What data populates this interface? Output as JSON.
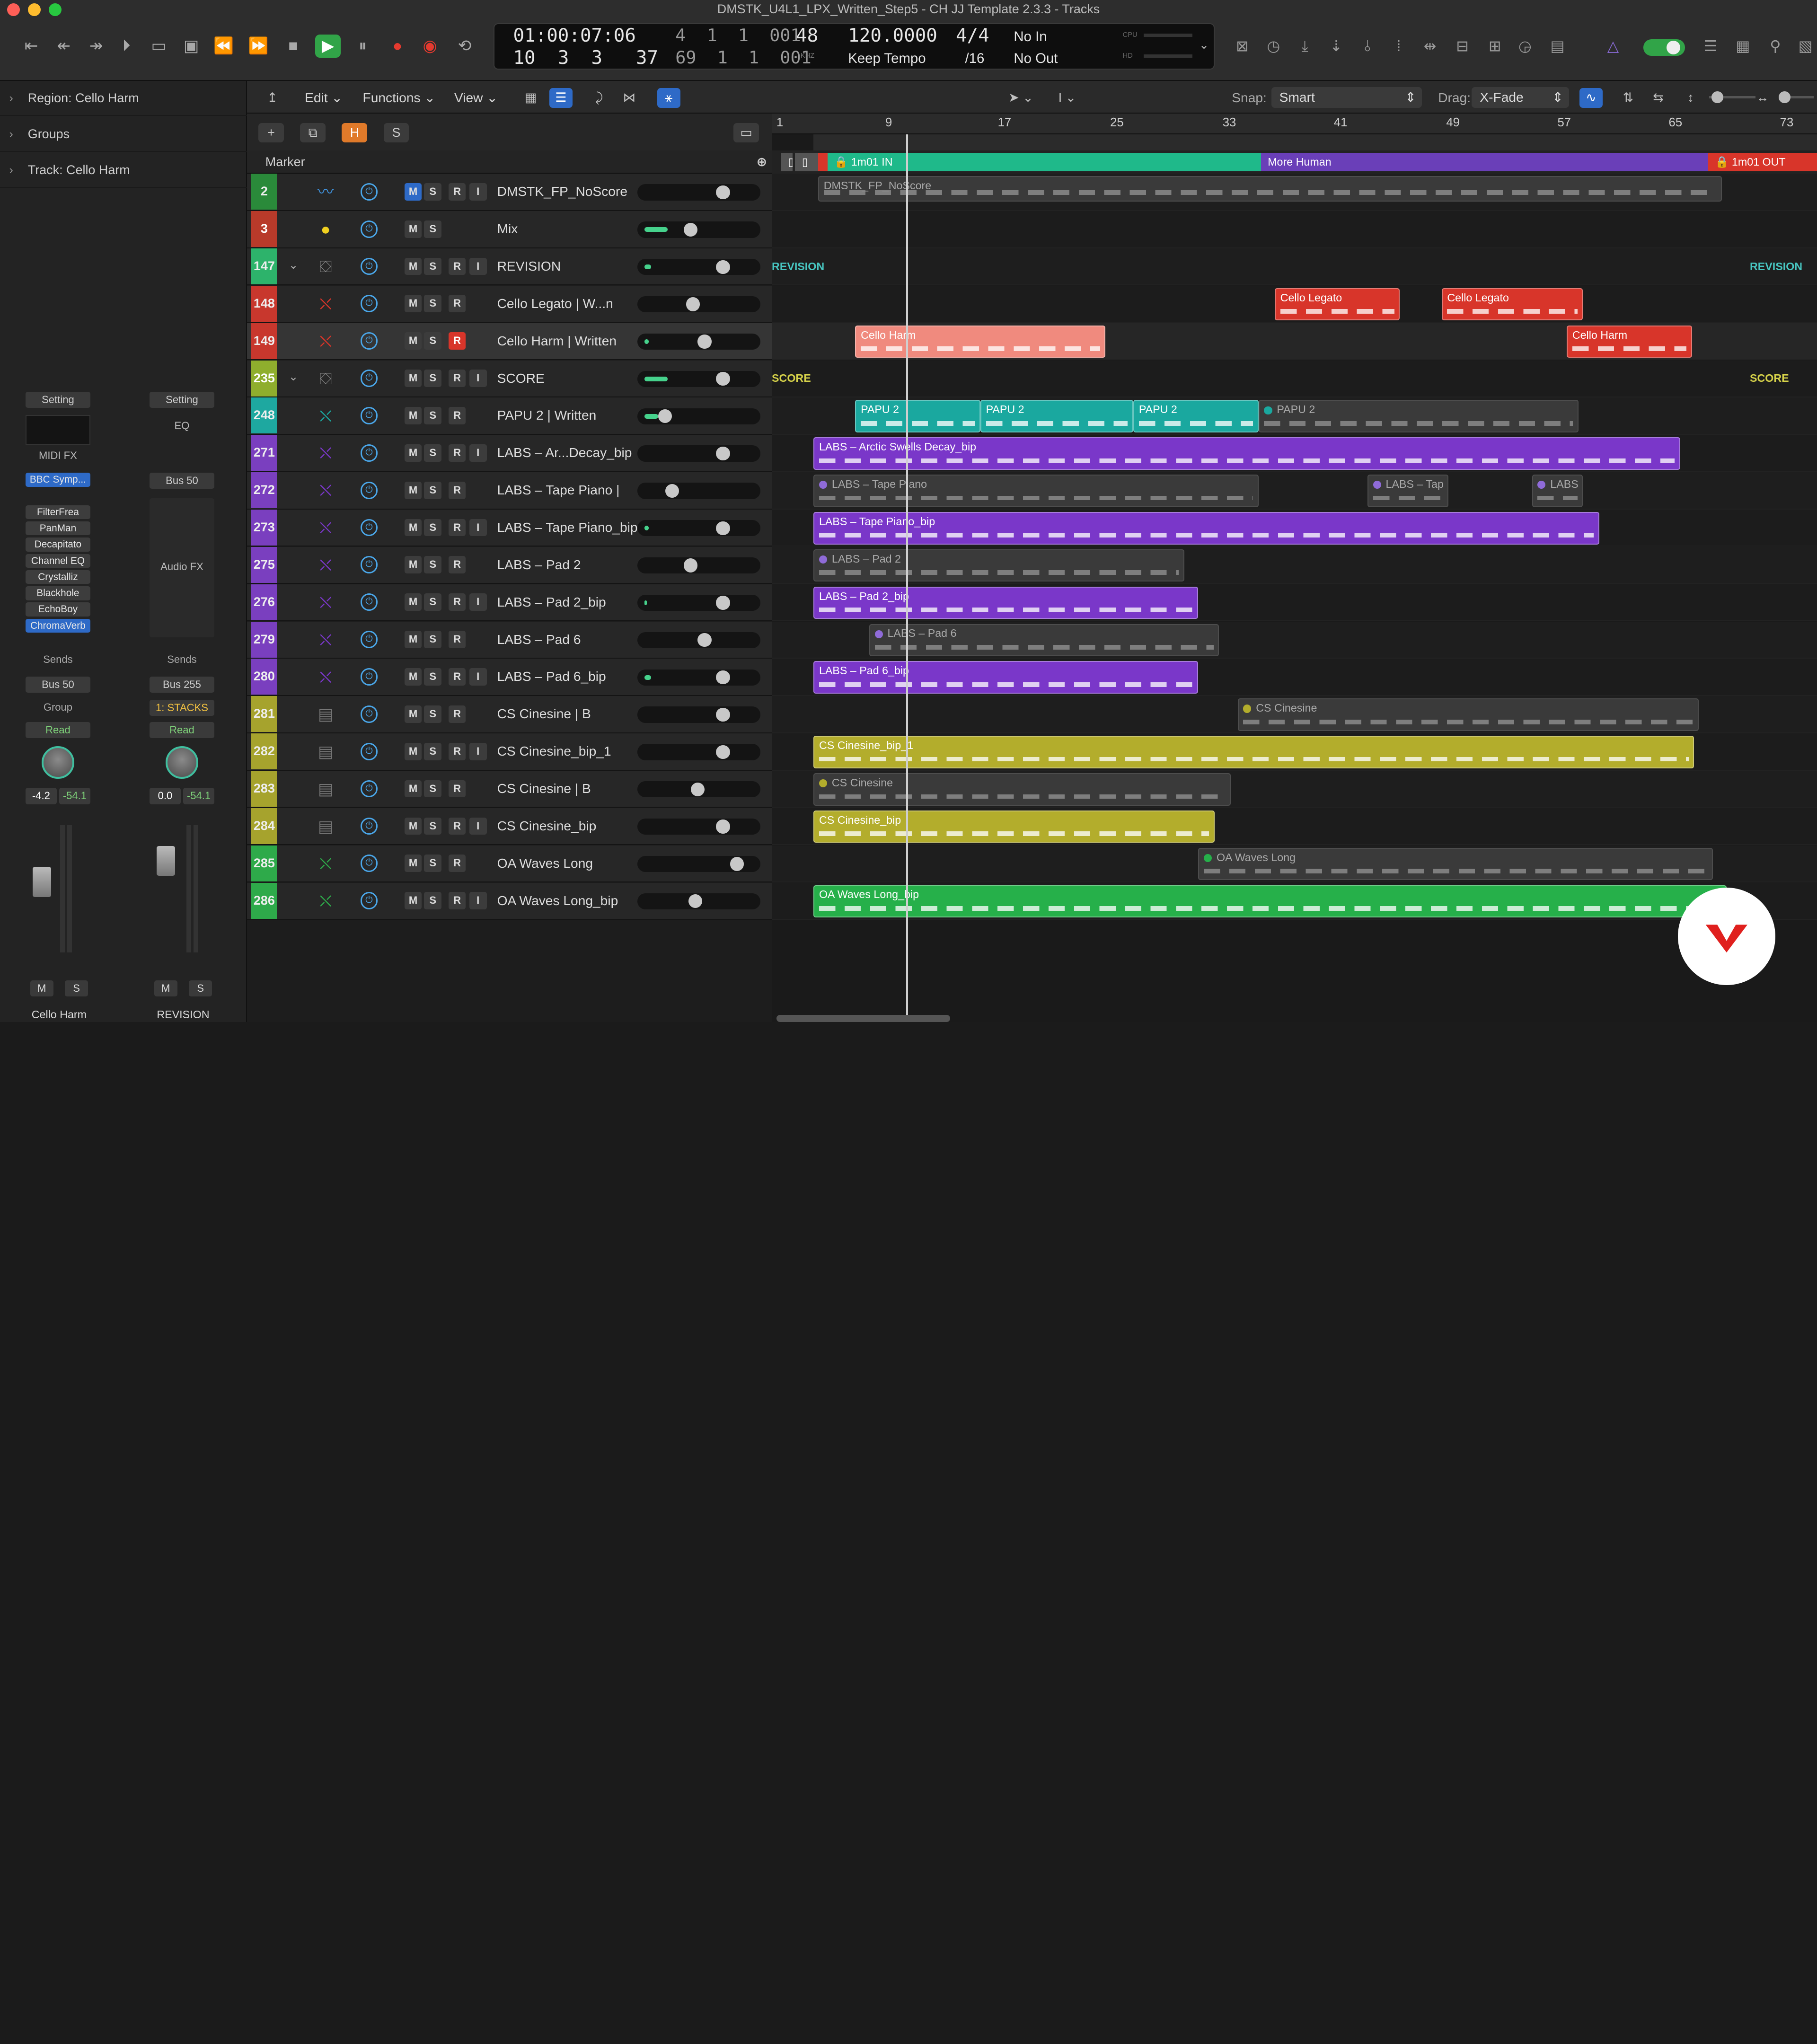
{
  "window": {
    "title": "DMSTK_U4L1_LPX_Written_Step5 - CH JJ Template 2.3.3 - Tracks"
  },
  "lcd": {
    "position_time": "01:00:07:06",
    "position_bars_top": "4  1  1  001",
    "position_bars_main": "10  3  3   37",
    "end_bars": "69  1  1  001",
    "division": "48",
    "khz": "KHZ",
    "tempo": "120.0000",
    "tempo_mode": "Keep Tempo",
    "signature": "4/4",
    "division_sig": "/16",
    "in": "No In",
    "out": "No Out",
    "cpu": "CPU",
    "hd": "HD"
  },
  "inspector": {
    "region_label": "Region:",
    "region_value": "Cello Harm",
    "groups_label": "Groups",
    "track_label": "Track:",
    "track_value": "Cello Harm",
    "left": {
      "setting": "Setting",
      "midi_fx": "MIDI FX",
      "instrument": "BBC Symp...",
      "plugins": [
        "FilterFrea",
        "PanMan",
        "Decapitato",
        "Channel EQ",
        "Crystalliz",
        "Blackhole",
        "EchoBoy",
        "ChromaVerb"
      ],
      "sends": "Sends",
      "send1": "Bus 50",
      "group": "Group",
      "automation": "Read",
      "vol": "-4.2",
      "peak": "-54.1",
      "m": "M",
      "s": "S",
      "name": "Cello Harm"
    },
    "right": {
      "setting": "Setting",
      "eq": "EQ",
      "input": "Bus 50",
      "audio_fx": "Audio FX",
      "sends": "Sends",
      "send1": "Bus 255",
      "output": "1: STACKS",
      "automation": "Read",
      "vol": "0.0",
      "peak": "-54.1",
      "m": "M",
      "s": "S",
      "name": "REVISION"
    }
  },
  "toolbar": {
    "edit": "Edit",
    "functions": "Functions",
    "view": "View",
    "snap_label": "Snap:",
    "snap_value": "Smart",
    "drag_label": "Drag:",
    "drag_value": "X-Fade"
  },
  "header": {
    "h": "H",
    "s": "S",
    "marker": "Marker",
    "plus": "+"
  },
  "ruler": [
    "1",
    "9",
    "17",
    "25",
    "33",
    "41",
    "49",
    "57",
    "65",
    "73"
  ],
  "markers": [
    {
      "name": "1m01 IN"
    },
    {
      "name": "More Human"
    },
    {
      "name": "1m01 OUT"
    }
  ],
  "tracks": [
    {
      "num": "2",
      "name": "DMSTK_FP_NoScore",
      "numcolor": "#2a8a3a",
      "m": "M",
      "s": "S",
      "r": "R",
      "i": "I"
    },
    {
      "num": "3",
      "name": "Mix",
      "numcolor": "#b83a2a",
      "m": "M",
      "s": "S"
    },
    {
      "num": "147",
      "name": "REVISION",
      "numcolor": "#2db36b",
      "m": "M",
      "s": "S",
      "r": "R",
      "i": "I"
    },
    {
      "num": "148",
      "name": "Cello Legato | W...n",
      "numcolor": "#c8372d",
      "m": "M",
      "s": "S",
      "r": "R"
    },
    {
      "num": "149",
      "name": "Cello Harm | Written",
      "numcolor": "#c8372d",
      "m": "M",
      "s": "S",
      "r": "R"
    },
    {
      "num": "235",
      "name": "SCORE",
      "numcolor": "#8fae2d",
      "m": "M",
      "s": "S",
      "r": "R",
      "i": "I"
    },
    {
      "num": "248",
      "name": "PAPU 2 | Written",
      "numcolor": "#1ea8a0",
      "m": "M",
      "s": "S",
      "r": "R"
    },
    {
      "num": "271",
      "name": "LABS – Ar...Decay_bip",
      "numcolor": "#7a3fbf",
      "m": "M",
      "s": "S",
      "r": "R",
      "i": "I"
    },
    {
      "num": "272",
      "name": "LABS – Tape Piano |",
      "numcolor": "#7a3fbf",
      "m": "M",
      "s": "S",
      "r": "R"
    },
    {
      "num": "273",
      "name": "LABS – Tape Piano_bip",
      "numcolor": "#7a3fbf",
      "m": "M",
      "s": "S",
      "r": "R",
      "i": "I"
    },
    {
      "num": "275",
      "name": "LABS – Pad 2",
      "numcolor": "#7a3fbf",
      "m": "M",
      "s": "S",
      "r": "R"
    },
    {
      "num": "276",
      "name": "LABS – Pad 2_bip",
      "numcolor": "#7a3fbf",
      "m": "M",
      "s": "S",
      "r": "R",
      "i": "I"
    },
    {
      "num": "279",
      "name": "LABS – Pad 6",
      "numcolor": "#7a3fbf",
      "m": "M",
      "s": "S",
      "r": "R"
    },
    {
      "num": "280",
      "name": "LABS – Pad 6_bip",
      "numcolor": "#7a3fbf",
      "m": "M",
      "s": "S",
      "r": "R",
      "i": "I"
    },
    {
      "num": "281",
      "name": "CS Cinesine | B",
      "numcolor": "#a6a32d",
      "m": "M",
      "s": "S",
      "r": "R"
    },
    {
      "num": "282",
      "name": "CS Cinesine_bip_1",
      "numcolor": "#a6a32d",
      "m": "M",
      "s": "S",
      "r": "R",
      "i": "I"
    },
    {
      "num": "283",
      "name": "CS Cinesine | B",
      "numcolor": "#a6a32d",
      "m": "M",
      "s": "S",
      "r": "R"
    },
    {
      "num": "284",
      "name": "CS Cinesine_bip",
      "numcolor": "#a6a32d",
      "m": "M",
      "s": "S",
      "r": "R",
      "i": "I"
    },
    {
      "num": "285",
      "name": "OA Waves Long",
      "numcolor": "#2eaa4a",
      "m": "M",
      "s": "S",
      "r": "R"
    },
    {
      "num": "286",
      "name": "OA Waves Long_bip",
      "numcolor": "#2eaa4a",
      "m": "M",
      "s": "S",
      "r": "R",
      "i": "I"
    }
  ],
  "regions": {
    "fp": "DMSTK_FP_NoScore",
    "revision": "REVISION",
    "score": "SCORE",
    "cello_legato": "Cello Legato",
    "cello_harm": "Cello Harm",
    "papu": "PAPU 2",
    "labs_arctic": "LABS – Arctic Swells Decay_bip",
    "labs_tape": "LABS – Tape Piano",
    "labs_tap": "LABS – Tap",
    "labs": "LABS",
    "labs_tape_bip": "LABS – Tape Piano_bip",
    "labs_pad2": "LABS – Pad 2",
    "labs_pad2_bip": "LABS – Pad 2_bip",
    "labs_pad6": "LABS – Pad 6",
    "labs_pad6_bip": "LABS – Pad 6_bip",
    "cs": "CS Cinesine",
    "cs_bip1": "CS Cinesine_bip_1",
    "cs_bip": "CS Cinesine_bip",
    "oa": "OA Waves Long",
    "oa_bip": "OA Waves Long_bip"
  },
  "colors": {
    "accent": "#2fa14a",
    "cello": "#d8352a",
    "papu": "#1aa89f",
    "labs": "#7a37c9",
    "cs": "#b3ad2c",
    "oa": "#26b04a",
    "marker_in": "#1fb98a",
    "marker_human": "#6a3fb8",
    "marker_out": "#d8352a"
  }
}
